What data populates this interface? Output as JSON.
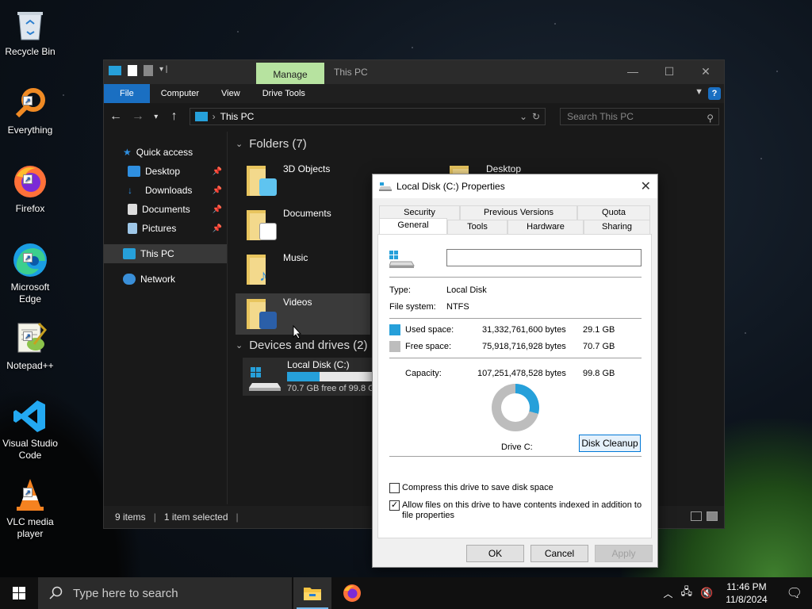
{
  "desktop": {
    "icons": [
      {
        "label": "Recycle Bin",
        "icon": "recycle-bin-icon"
      },
      {
        "label": "Everything",
        "icon": "everything-search-icon"
      },
      {
        "label": "Firefox",
        "icon": "firefox-icon"
      },
      {
        "label": "Microsoft Edge",
        "icon": "edge-icon"
      },
      {
        "label": "Notepad++",
        "icon": "notepadpp-icon"
      },
      {
        "label": "Visual Studio Code",
        "icon": "vscode-icon"
      },
      {
        "label": "VLC media player",
        "icon": "vlc-icon"
      }
    ]
  },
  "explorer": {
    "title": "This PC",
    "manage_tab": "Manage",
    "ribbon": {
      "file": "File",
      "computer": "Computer",
      "view": "View",
      "drive_tools": "Drive Tools",
      "help": "?"
    },
    "address": "This PC",
    "search_placeholder": "Search This PC",
    "nav": {
      "quick_access": "Quick access",
      "desktop": "Desktop",
      "downloads": "Downloads",
      "documents": "Documents",
      "pictures": "Pictures",
      "this_pc": "This PC",
      "network": "Network"
    },
    "folders_header": "Folders (7)",
    "folders": [
      "3D Objects",
      "Documents",
      "Music",
      "Videos",
      "Desktop"
    ],
    "devices_header": "Devices and drives (2)",
    "drive": {
      "name": "Local Disk (C:)",
      "free_text": "70.7 GB free of 99.8 GB",
      "used_fraction": 0.292
    },
    "status": {
      "items": "9 items",
      "selected": "1 item selected"
    }
  },
  "props": {
    "title": "Local Disk (C:) Properties",
    "tabs_top": [
      "Security",
      "Previous Versions",
      "Quota"
    ],
    "tabs_bottom": [
      "General",
      "Tools",
      "Hardware",
      "Sharing"
    ],
    "name_value": "",
    "type_label": "Type:",
    "type_value": "Local Disk",
    "fs_label": "File system:",
    "fs_value": "NTFS",
    "used_label": "Used space:",
    "used_bytes": "31,332,761,600 bytes",
    "used_gb": "29.1 GB",
    "free_label": "Free space:",
    "free_bytes": "75,918,716,928 bytes",
    "free_gb": "70.7 GB",
    "cap_label": "Capacity:",
    "cap_bytes": "107,251,478,528 bytes",
    "cap_gb": "99.8 GB",
    "drive_label": "Drive C:",
    "cleanup": "Disk Cleanup",
    "compress": "Compress this drive to save disk space",
    "compress_checked": false,
    "index_line1": "Allow files on this drive to have contents indexed in addition to",
    "index_line2": "file properties",
    "index_checked": true,
    "ok": "OK",
    "cancel": "Cancel",
    "apply": "Apply",
    "used_color": "#26a0da",
    "free_color": "#bdbdbd"
  },
  "taskbar": {
    "search_placeholder": "Type here to search",
    "time": "11:46 PM",
    "date": "11/8/2024"
  }
}
